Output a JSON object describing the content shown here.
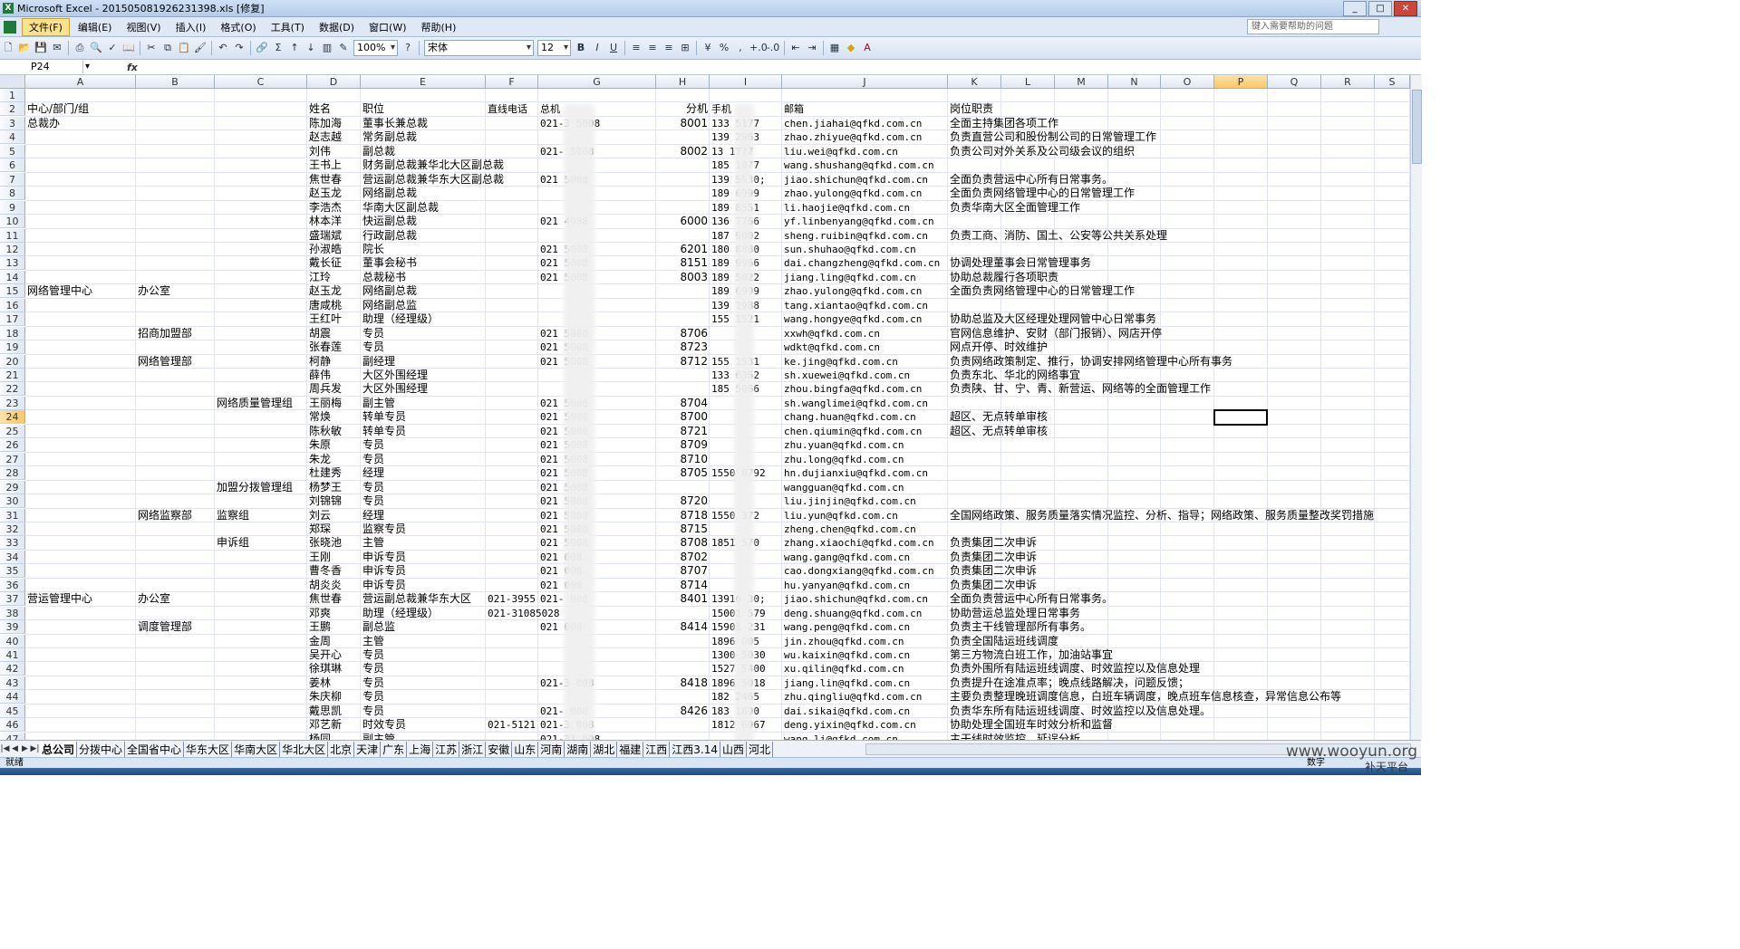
{
  "window": {
    "title": "Microsoft Excel - 20150508192623​1398.xls  [修复]",
    "min": "_",
    "max": "□",
    "close": "✕"
  },
  "menu": [
    "文件(F)",
    "编辑(E)",
    "视图(V)",
    "插入(I)",
    "格式(O)",
    "工具(T)",
    "数据(D)",
    "窗口(W)",
    "帮助(H)"
  ],
  "help_placeholder": "键入需要帮助的问题",
  "toolbar": {
    "zoom": "100%",
    "font": "宋体",
    "size": "12"
  },
  "formula": {
    "namebox": "P24",
    "fx": "fx",
    "content": ""
  },
  "columns": [
    "A",
    "B",
    "C",
    "D",
    "E",
    "F",
    "G",
    "H",
    "I",
    "J",
    "K",
    "L",
    "M",
    "N",
    "O",
    "P",
    "Q",
    "R",
    "S"
  ],
  "active_cell": {
    "col": "P",
    "row": 24
  },
  "rows": [
    {
      "n": 1
    },
    {
      "n": 2,
      "A": "中心/部门/组",
      "D": "姓名",
      "E": "职位",
      "F": "直线电话",
      "G": "总机",
      "H": "分机",
      "I": "手机",
      "J": "邮箱",
      "K": "岗位职责"
    },
    {
      "n": 3,
      "A": "总裁办",
      "D": "陈加海",
      "E": "董事长兼总裁",
      "G": "021-3  5008",
      "H": "8001",
      "I": "133  5177",
      "J": "chen.jiahai@qfkd.com.cn",
      "K": "全面主持集团各项工作"
    },
    {
      "n": 4,
      "D": "赵志越",
      "E": "常务副总裁",
      "I": "139  2963",
      "J": "zhao.zhiyue@qfkd.com.cn",
      "K": "负责直营公司和股份制公司的日常管理工作"
    },
    {
      "n": 5,
      "D": "刘伟",
      "E": "副总裁",
      "G": "021-  5008",
      "H": "8002",
      "I": "13  1777",
      "J": "liu.wei@qfkd.com.cn",
      "K": "负责公司对外关系及公司级会议的组织"
    },
    {
      "n": 6,
      "D": "王书上",
      "E": "财务副总裁兼华北大区副总裁",
      "I": "185  1877",
      "J": "wang.shushang@qfkd.com.cn"
    },
    {
      "n": 7,
      "D": "焦世春",
      "E": "营运副总裁兼华东大区副总裁",
      "G": "021  5008",
      "I": "139  5530;",
      "J": "jiao.shichun@qfkd.com.cn",
      "K": "全面负责营运中心所有日常事务。"
    },
    {
      "n": 8,
      "D": "赵玉龙",
      "E": "网络副总裁",
      "I": "189  6999",
      "J": "zhao.yulong@qfkd.com.cn",
      "K": "全面负责网络管理中心的日常管理工作"
    },
    {
      "n": 9,
      "D": "李浩杰",
      "E": "华南大区副总裁",
      "I": "189  8551",
      "J": "li.haojie@qfkd.com.cn",
      "K": "负责华南大区全面管理工作"
    },
    {
      "n": 10,
      "D": "林本洋",
      "E": "快运副总裁",
      "G": "021  4988",
      "H": "6000",
      "I": "136  7766",
      "J": "yf.linbenyang@qfkd.com.cn"
    },
    {
      "n": 11,
      "D": "盛瑞斌",
      "E": "行政副总裁",
      "I": "187  9002",
      "J": "sheng.ruibin@qfkd.com.cn",
      "K": "负责工商、消防、国土、公安等公共关系处理"
    },
    {
      "n": 12,
      "D": "孙淑皓",
      "E": "院长",
      "G": "021  5008",
      "H": "6201",
      "I": "180  8880",
      "J": "sun.shuhao@qfkd.com.cn"
    },
    {
      "n": 13,
      "D": "戴长征",
      "E": "董事会秘书",
      "G": "021  5008",
      "H": "8151",
      "I": "189  9966",
      "J": "dai.changzheng@qfkd.com.cn",
      "K": "协调处理董事会日常管理事务"
    },
    {
      "n": 14,
      "D": "江玲",
      "E": "总裁秘书",
      "G": "021  5008",
      "H": "8003",
      "I": "189  5022",
      "J": "jiang.ling@qfkd.com.cn",
      "K": "协助总裁履行各项职责"
    },
    {
      "n": 15,
      "A": "网络管理中心",
      "B": "办公室",
      "D": "赵玉龙",
      "E": "网络副总裁",
      "I": "189  6999",
      "J": "zhao.yulong@qfkd.com.cn",
      "K": "全面负责网络管理中心的日常管理工作"
    },
    {
      "n": 16,
      "D": "唐咸桃",
      "E": "网络副总监",
      "I": "139  1988",
      "J": "tang.xiantao@qfkd.com.cn"
    },
    {
      "n": 17,
      "D": "王红叶",
      "E": "助理（经理级）",
      "I": "155  1521",
      "J": "wang.hongye@qfkd.com.cn",
      "K": "协助总监及大区经理处理网管中心日常事务"
    },
    {
      "n": 18,
      "B": "招商加盟部",
      "D": "胡震",
      "E": "专员",
      "G": "021  5008",
      "H": "8706",
      "J": "xxwh@qfkd.com.cn",
      "K": "官网信息维护、安财（部门报销）、网店开停"
    },
    {
      "n": 19,
      "D": "张春莲",
      "E": "专员",
      "G": "021  5008",
      "H": "8723",
      "J": "wdkt@qfkd.com.cn",
      "K": "网点开停、时效维护"
    },
    {
      "n": 20,
      "B": "网络管理部",
      "D": "柯静",
      "E": "副经理",
      "G": "021  5008",
      "H": "8712",
      "I": "155  1531",
      "J": "ke.jing@qfkd.com.cn",
      "K": "负责网络政策制定、推行，协调安排网络管理中心所有事务"
    },
    {
      "n": 21,
      "D": "薛伟",
      "E": "大区外围经理",
      "I": "133  6362",
      "J": "sh.xuewei@qfkd.com.cn",
      "K": "负责东北、华北的网络事宜"
    },
    {
      "n": 22,
      "D": "周兵发",
      "E": "大区外围经理",
      "I": "185  5066",
      "J": "zhou.bingfa@qfkd.com.cn",
      "K": "负责陕、甘、宁、青、新营运、网络等的全面管理工作"
    },
    {
      "n": 23,
      "C": "网络质量管理组",
      "D": "王丽梅",
      "E": "副主管",
      "G": "021  5008",
      "H": "8704",
      "J": "sh.wanglimei@qfkd.com.cn"
    },
    {
      "n": 24,
      "D": "常焕",
      "E": "转单专员",
      "G": "021  5008",
      "H": "8700",
      "J": "chang.huan@qfkd.com.cn",
      "K": "超区、无点转单审核"
    },
    {
      "n": 25,
      "D": "陈秋敏",
      "E": "转单专员",
      "G": "021  5008",
      "H": "8721",
      "J": "chen.qiumin@qfkd.com.cn",
      "K": "超区、无点转单审核"
    },
    {
      "n": 26,
      "D": "朱原",
      "E": "专员",
      "G": "021  5008",
      "H": "8709",
      "J": "zhu.yuan@qfkd.com.cn"
    },
    {
      "n": 27,
      "D": "朱龙",
      "E": "专员",
      "G": "021  5008",
      "H": "8710",
      "J": "zhu.long@qfkd.com.cn"
    },
    {
      "n": 28,
      "D": "杜建秀",
      "E": "经理",
      "G": "021  5008",
      "H": "8705",
      "I": "1550  0792",
      "J": "hn.dujianxiu@qfkd.com.cn"
    },
    {
      "n": 29,
      "C": "加盟分拨管理组",
      "D": "杨梦王",
      "E": "专员",
      "G": "021  5008",
      "J": "wangguan@qfkd.com.cn"
    },
    {
      "n": 30,
      "D": "刘锦锦",
      "E": "专员",
      "G": "021  5008",
      "H": "8720",
      "J": "liu.jinjin@qfkd.com.cn"
    },
    {
      "n": 31,
      "B": "网络监察部",
      "C": "监察组",
      "D": "刘云",
      "E": "经理",
      "G": "021  5008",
      "H": "8718",
      "I": "1550  372",
      "J": "liu.yun@qfkd.com.cn",
      "K": "全国网络政策、服务质量落实情况监控、分析、指导；网络政策、服务质量整改奖罚措施"
    },
    {
      "n": 32,
      "D": "郑琛",
      "E": "监察专员",
      "G": "021  5008",
      "H": "8715",
      "J": "zheng.chen@qfkd.com.cn"
    },
    {
      "n": 33,
      "C": "申诉组",
      "D": "张晓池",
      "E": "主管",
      "G": "021  5008",
      "H": "8708",
      "I": "1851  570",
      "J": "zhang.xiaochi@qfkd.com.cn",
      "K": "负责集团二次申诉"
    },
    {
      "n": 34,
      "D": "王刚",
      "E": "申诉专员",
      "G": "021  008",
      "H": "8702",
      "J": "wang.gang@qfkd.com.cn",
      "K": "负责集团二次申诉"
    },
    {
      "n": 35,
      "D": "曹冬香",
      "E": "申诉专员",
      "G": "021  008",
      "H": "8707",
      "J": "cao.dongxiang@qfkd.com.cn",
      "K": "负责集团二次申诉"
    },
    {
      "n": 36,
      "D": "胡炎炎",
      "E": "申诉专员",
      "G": "021  008",
      "H": "8714",
      "J": "hu.yanyan@qfkd.com.cn",
      "K": "负责集团二次申诉"
    },
    {
      "n": 37,
      "A": "营运管理中心",
      "B": "办公室",
      "D": "焦世春",
      "E": "营运副总裁兼华东大区",
      "F": "021-3955",
      "G": "021-  008",
      "H": "8401",
      "I": "13916  30;",
      "J": "jiao.shichun@qfkd.com.cn",
      "K": "全面负责营运中心所有日常事务。"
    },
    {
      "n": 38,
      "D": "邓爽",
      "E": "助理（经理级）",
      "F": "021-31085028",
      "I": "15001  579",
      "J": "deng.shuang@qfkd.com.cn",
      "K": "协助营运总监处理日常事务"
    },
    {
      "n": 39,
      "B": "调度管理部",
      "D": "王鹏",
      "E": "副总监",
      "G": "021  008",
      "H": "8414",
      "I": "15901  231",
      "J": "wang.peng@qfkd.com.cn",
      "K": "负责主干线管理部所有事务。"
    },
    {
      "n": 40,
      "D": "金周",
      "E": "主管",
      "I": "1896  005",
      "J": "jin.zhou@qfkd.com.cn",
      "K": "负责全国陆运班线调度"
    },
    {
      "n": 41,
      "D": "吴开心",
      "E": "专员",
      "I": "1300  5030",
      "J": "wu.kaixin@qfkd.com.cn",
      "K": "第三方物流白班工作，加油站事宜"
    },
    {
      "n": 42,
      "D": "徐琪琳",
      "E": "专员",
      "I": "1527  5400",
      "J": "xu.qilin@qfkd.com.cn",
      "K": "负责外围所有陆运班线调度、时效监控以及信息处理"
    },
    {
      "n": 43,
      "D": "姜林",
      "E": "专员",
      "G": "021-3  008",
      "H": "8418",
      "I": "1896  5018",
      "J": "jiang.lin@qfkd.com.cn",
      "K": "负责提升在途准点率；晚点线路解决，问题反馈；"
    },
    {
      "n": 44,
      "D": "朱庆柳",
      "E": "专员",
      "I": "182  2465",
      "J": "zhu.qingliu@qfkd.com.cn",
      "K": "主要负责整理晚班调度信息，白班车辆调度，晚点班车信息核查，异常信息公布等"
    },
    {
      "n": 45,
      "D": "戴思凯",
      "E": "专员",
      "G": "021-  008",
      "H": "8426",
      "I": "183  1690",
      "J": "dai.sikai@qfkd.com.cn",
      "K": "负责华东所有陆运班线调度、时效监控以及信息处理。"
    },
    {
      "n": 46,
      "D": "邓艺新",
      "E": "时效专员",
      "F": "021-5121",
      "G": "021-3  008",
      "I": "1812  6967",
      "J": "deng.yixin@qfkd.com.cn",
      "K": "协助处理全国班车时效分析和监督"
    },
    {
      "n": 47,
      "D": "杨同",
      "E": "副主管",
      "G": "021-31  008",
      "J": "wang.li@qfkd.com.cn",
      "K": "主干线时效监控、延误分析"
    }
  ],
  "sheets": [
    "总公司",
    "分拨中心",
    "全国省中心",
    "华东大区",
    "华南大区",
    "华北大区",
    "北京",
    "天津",
    "广东",
    "上海",
    "江苏",
    "浙江",
    "安徽",
    "山东",
    "河南",
    "湖南",
    "湖北",
    "福建",
    "江西",
    "江西3.14",
    "山西",
    "河北"
  ],
  "active_sheet": "总公司",
  "status": {
    "ready": "就绪",
    "numlock": "数字"
  },
  "watermark": "www.wooyun.org",
  "watermark2": "补天平台"
}
